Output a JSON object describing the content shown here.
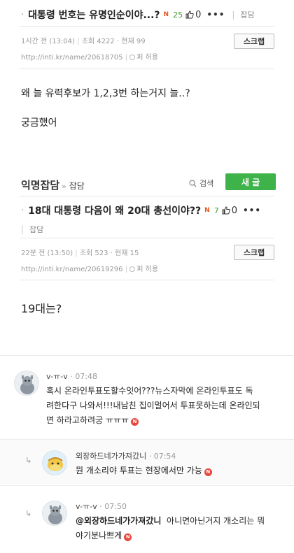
{
  "post1": {
    "bullet": "·",
    "title": "대통령 번호는 유명인순이야...?",
    "new_badge": "N",
    "count": "25",
    "likes": "0",
    "more": "•••",
    "board": "잡담",
    "time": "1시간 전 (13:04)",
    "views": "조회 4222 · 현재 99",
    "url": "http://inti.kr/name/20618705",
    "license": "퍼 허용",
    "scrap_label": "스크랩",
    "body_lines": [
      "왜 늘 유력후보가 1,2,3번 하는거지 늘..?",
      "궁금했어"
    ]
  },
  "board_bar": {
    "name": "익명잡담",
    "crumb_sep": "»",
    "crumb": "잡담",
    "search_label": "검색",
    "write_label": "새 글"
  },
  "post2": {
    "bullet": "·",
    "title": "18대 대통령 다음이 왜 20대 총선이야??",
    "new_badge": "N",
    "count": "7",
    "likes": "0",
    "more": "•••",
    "board": "잡담",
    "time": "22분 전 (13:50)",
    "views": "조회 523 · 현재 15",
    "url": "http://inti.kr/name/20619296",
    "license": "퍼 허용",
    "scrap_label": "스크랩",
    "body_lines": [
      "19대는?"
    ]
  },
  "comments": [
    {
      "name": "v-ㅠ-v",
      "time": "07:48",
      "lines": [
        "혹시 온라인투표도할수잇어???뉴스자막에 온라인투표도 독",
        "려한다구 나와서!!!내남친 집이멀어서 투표못하는데 온라인되",
        "면 하라고하려궁 ㅠㅠㅠ"
      ],
      "badge": "N"
    },
    {
      "reply_mark": "↳",
      "name": "외장하드네가가져갔니",
      "time": "07:54",
      "lines": [
        "뭔 개소리야 투표는 현장에서만 가능"
      ],
      "badge": "N"
    },
    {
      "reply_mark": "↳",
      "name": "v-ㅠ-v",
      "time": "07:50",
      "mention": "@외장하드네가가져갔니",
      "line1_rest": "  아니면아닌거지 개소리는 뭐",
      "line2": "야기분나쁘게",
      "badge": "N"
    }
  ],
  "colors": {
    "accent_green": "#3db34a",
    "new_badge": "#e8551c",
    "n_badge": "#e8453c"
  }
}
